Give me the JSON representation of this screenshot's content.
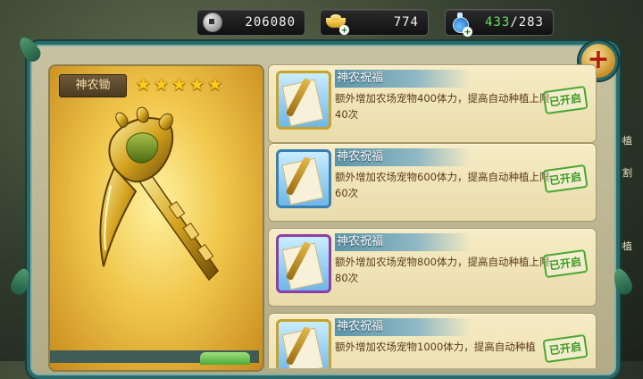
{
  "resources": {
    "coins": "206080",
    "ingots": "774",
    "stamina_current": "433",
    "stamina_separator": "/",
    "stamina_max": "283"
  },
  "colors": {
    "panel_border": "#2b6a6a",
    "card_bg": "#f6ecc6",
    "star": "#ffcc1a",
    "stamp_green": "#3a9a22",
    "frame_gold": "#c9a227",
    "frame_blue": "#3a7fb0",
    "frame_purple": "#8a3fa8"
  },
  "item": {
    "name": "神农锄",
    "stars": 5
  },
  "close_button": {
    "icon": "plus-close-icon",
    "glyph": "+"
  },
  "cards": [
    {
      "title": "神农祝福",
      "desc": "额外增加农场宠物400体力，提高自动种植上限40次",
      "status": "已开启",
      "frame": "gold"
    },
    {
      "title": "神农祝福",
      "desc": "额外增加农场宠物600体力，提高自动种植上限60次",
      "status": "已开启",
      "frame": "blue"
    },
    {
      "title": "神农祝福",
      "desc": "额外增加农场宠物800体力，提高自动种植上限80次",
      "status": "已开启",
      "frame": "purple"
    },
    {
      "title": "神农祝福",
      "desc": "额外增加农场宠物1000体力，提高自动种植",
      "status": "已开启",
      "frame": "gold"
    }
  ],
  "side_labels": [
    "种植",
    "收割",
    "种植"
  ]
}
